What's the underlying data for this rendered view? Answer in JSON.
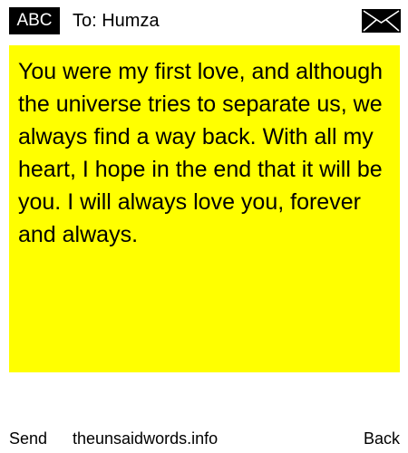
{
  "header": {
    "badge_label": "ABC",
    "to_label": "To: Humza",
    "envelope_icon": "envelope-icon"
  },
  "message": {
    "text": "You were my first love, and although the universe tries to separate us, we always find a way back. With all my heart, I hope in the end that it will be you. I will always love you, forever and always.",
    "background_color": "#ffff00"
  },
  "footer": {
    "send_label": "Send",
    "site_label": "theunsaidwords.info",
    "back_label": "Back"
  }
}
